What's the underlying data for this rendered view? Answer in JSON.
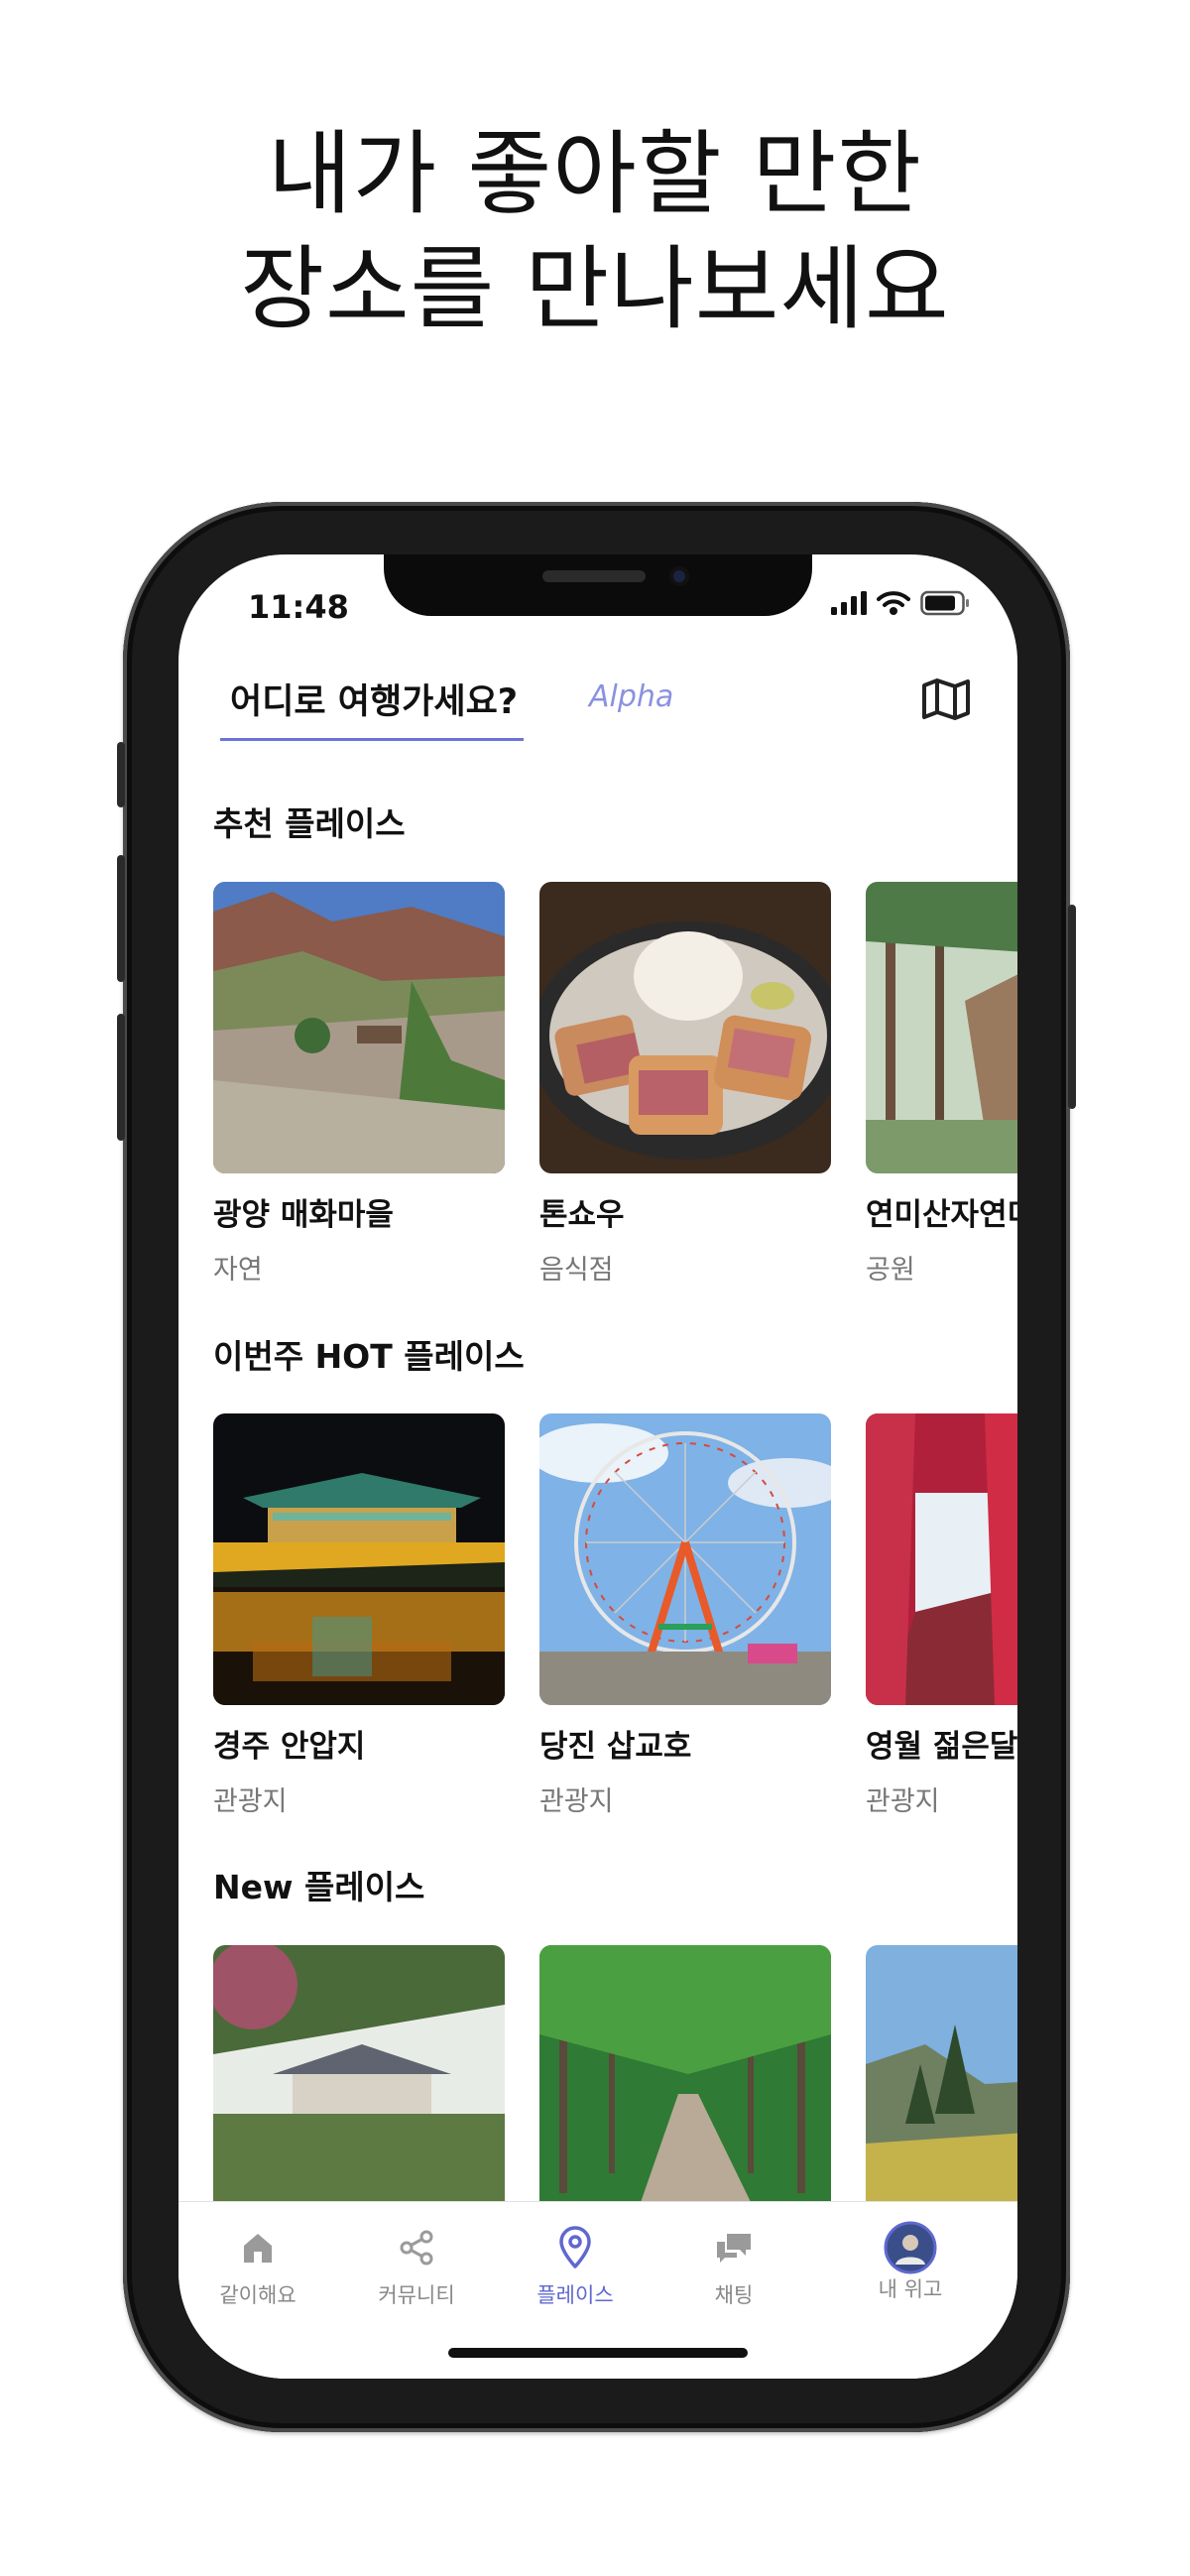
{
  "headline": {
    "line1": "내가 좋아할 만한",
    "line2": "장소를 만나보세요"
  },
  "status_bar": {
    "time": "11:48"
  },
  "header": {
    "title": "어디로 여행가세요?",
    "badge": "Alpha",
    "map_icon": "map-icon"
  },
  "sections": [
    {
      "title": "추천 플레이스",
      "cards": [
        {
          "name": "광양 매화마을",
          "category": "자연"
        },
        {
          "name": "톤쇼우",
          "category": "음식점"
        },
        {
          "name": "연미산자연미",
          "category": "공원"
        }
      ]
    },
    {
      "title": "이번주 HOT 플레이스",
      "cards": [
        {
          "name": "경주 안압지",
          "category": "관광지"
        },
        {
          "name": "당진 삽교호",
          "category": "관광지"
        },
        {
          "name": "영월 젊은달",
          "category": "관광지"
        }
      ]
    },
    {
      "title": "New 플레이스",
      "cards": [
        {
          "name": "",
          "category": ""
        },
        {
          "name": "",
          "category": ""
        },
        {
          "name": "",
          "category": ""
        }
      ]
    }
  ],
  "tabbar": {
    "items": [
      {
        "label": "같이해요",
        "icon": "home-icon"
      },
      {
        "label": "커뮤니티",
        "icon": "share-icon"
      },
      {
        "label": "플레이스",
        "icon": "location-pin-icon",
        "active": true
      },
      {
        "label": "채팅",
        "icon": "chat-icon"
      },
      {
        "label": "내 위고",
        "icon": "avatar"
      }
    ]
  },
  "colors": {
    "accent": "#5f68cf",
    "underline": "#6b74d6",
    "alpha": "#8a91e0"
  }
}
